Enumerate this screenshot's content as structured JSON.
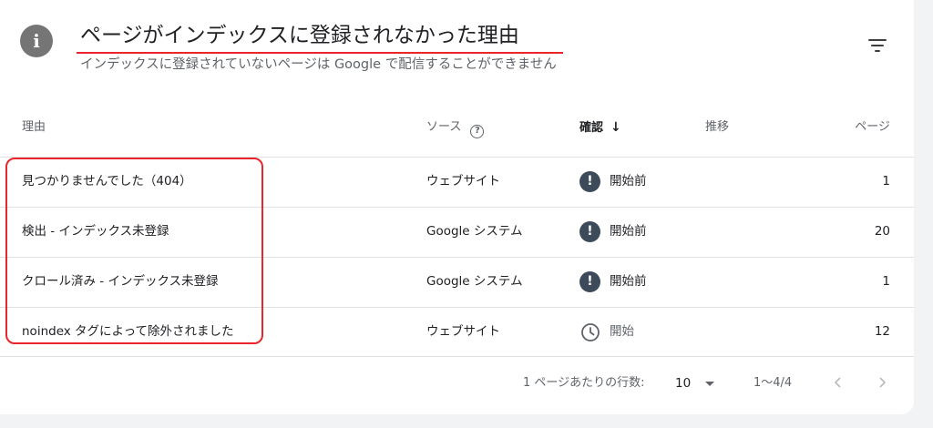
{
  "header": {
    "title": "ページがインデックスに登録されなかった理由",
    "subtitle": "インデックスに登録されていないページは Google で配信することができません"
  },
  "table": {
    "columns": {
      "reason": "理由",
      "source": "ソース",
      "validation": "確認",
      "trend": "推移",
      "pages": "ページ"
    },
    "rows": [
      {
        "reason": "見つかりませんでした（404）",
        "source": "ウェブサイト",
        "status": "開始前",
        "status_icon": "exclamation-icon",
        "pages": "1"
      },
      {
        "reason": "検出 - インデックス未登録",
        "source": "Google システム",
        "status": "開始前",
        "status_icon": "exclamation-icon",
        "pages": "20"
      },
      {
        "reason": "クロール済み - インデックス未登録",
        "source": "Google システム",
        "status": "開始前",
        "status_icon": "exclamation-icon",
        "pages": "1"
      },
      {
        "reason": "noindex タグによって除外されました",
        "source": "ウェブサイト",
        "status": "開始",
        "status_icon": "clock-icon",
        "pages": "12"
      }
    ]
  },
  "footer": {
    "rows_per_page_label": "1 ページあたりの行数:",
    "rows_per_page_value": "10",
    "range": "1〜4/4"
  },
  "colors": {
    "annotation_red": "#e8262b",
    "status_icon_dark": "#3c4a5a",
    "muted_text": "#5f6368"
  }
}
